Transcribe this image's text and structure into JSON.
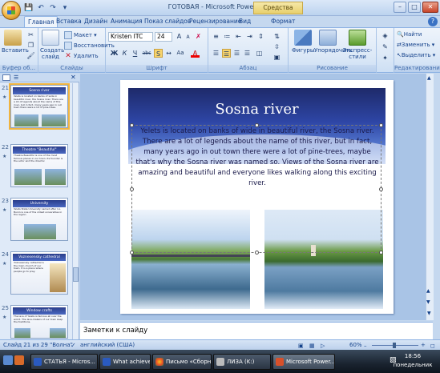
{
  "window": {
    "app_title": "ГОТОВАЯ - Microsoft PowerPoint",
    "context_group": "Средства рисования",
    "controls": [
      "–",
      "□",
      "✕"
    ]
  },
  "tabs": [
    "Главная",
    "Вставка",
    "Дизайн",
    "Анимация",
    "Показ слайдов",
    "Рецензирование",
    "Вид",
    "Формат"
  ],
  "ribbon": {
    "clipboard": {
      "paste": "Вставить",
      "group": "Буфер об..."
    },
    "slides": {
      "new_slide": "Создать слайд",
      "layout": "Макет",
      "reset": "Восстановить",
      "delete": "Удалить",
      "group": "Слайды"
    },
    "font": {
      "name": "Kristen ITC",
      "size": "24",
      "group": "Шрифт",
      "bold": "Ж",
      "italic": "К",
      "underline": "Ч",
      "strike": "abc",
      "shadow": "S",
      "font_color": "A",
      "grow": "A",
      "shrink": "A",
      "case": "Aa"
    },
    "paragraph": {
      "group": "Абзац"
    },
    "drawing": {
      "shapes": "Фигуры",
      "arrange": "Упорядочить",
      "quick_styles": "Экспресс-стили",
      "group": "Рисование"
    },
    "editing": {
      "find": "Найти",
      "replace": "Заменить",
      "select": "Выделить",
      "group": "Редактирование"
    }
  },
  "thumbnails": [
    {
      "num": "21",
      "title": "Sosna river",
      "text": "Yelets is located on banks of wide in beautiful river, the Sosna river. There are a lot of legends about the name of this river, but in fact, many years ago in out town there were a lot of pine-trees."
    },
    {
      "num": "22",
      "title": "Theatre \"Beautiful\"",
      "text": "Theatre Beautiful is one of the most famous places in our town. Its founder is the actor and the director."
    },
    {
      "num": "23",
      "title": "University",
      "text": "Yelets State University named after I.A. Bunin is one of the oldest universities in the region."
    },
    {
      "num": "24",
      "title": "Voznesensky cathedral",
      "text": "Voznesensky cathedral is the main church of our town. It is a place where people go to pray."
    },
    {
      "num": "25",
      "title": "Window crafts",
      "text": "The lace of Yelets is famous all over the world. The lace-makers of our town keep the traditions."
    }
  ],
  "slide": {
    "title": "Sosna river",
    "body": "Yelets is located on banks of wide in beautiful river, the Sosna river. There are a lot of legends about the name of this river, but in fact, many years ago in out town there were a lot of pine-trees, maybe that's why the Sosna river was named so. Views of the Sosna river are amazing and beautiful and everyone likes walking along this exciting river."
  },
  "notes_placeholder": "Заметки к слайду",
  "status": {
    "slide": "Слайд 21 из 29",
    "theme": "\"Волна\"",
    "language": "английский (США)",
    "zoom": "60%"
  },
  "taskbar": {
    "items": [
      "СТАТЬЯ - Micros...",
      "What achievem...",
      "Письмо «Сборн...",
      "ЛИЗА (K:)",
      "Microsoft Power..."
    ],
    "time": "18:56",
    "day": "понедельник"
  },
  "colors": {
    "ribbon": "#dde9f7",
    "title_banner": "#2e46a6",
    "selection": "#f0b440"
  }
}
